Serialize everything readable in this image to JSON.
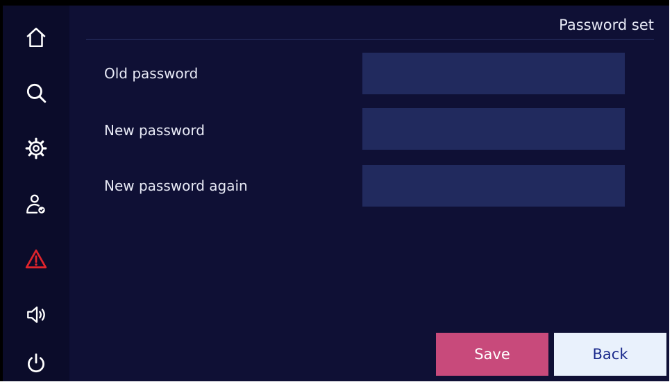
{
  "header": {
    "title": "Password set"
  },
  "sidebar": {
    "items": [
      {
        "name": "home",
        "icon": "home-icon"
      },
      {
        "name": "search",
        "icon": "search-icon"
      },
      {
        "name": "settings",
        "icon": "gear-icon"
      },
      {
        "name": "user",
        "icon": "user-check-icon"
      },
      {
        "name": "alarm",
        "icon": "warning-icon",
        "color": "#e0242c"
      },
      {
        "name": "sound",
        "icon": "speaker-icon"
      },
      {
        "name": "power",
        "icon": "power-icon"
      }
    ]
  },
  "form": {
    "old_password": {
      "label": "Old password",
      "value": ""
    },
    "new_password": {
      "label": "New password",
      "value": ""
    },
    "new_password_again": {
      "label": "New password again",
      "value": ""
    }
  },
  "actions": {
    "save_label": "Save",
    "back_label": "Back"
  },
  "colors": {
    "background": "#0f1035",
    "input": "#212a5e",
    "save": "#c84a7b",
    "back": "#e9f1fc",
    "alarm": "#e0242c"
  }
}
